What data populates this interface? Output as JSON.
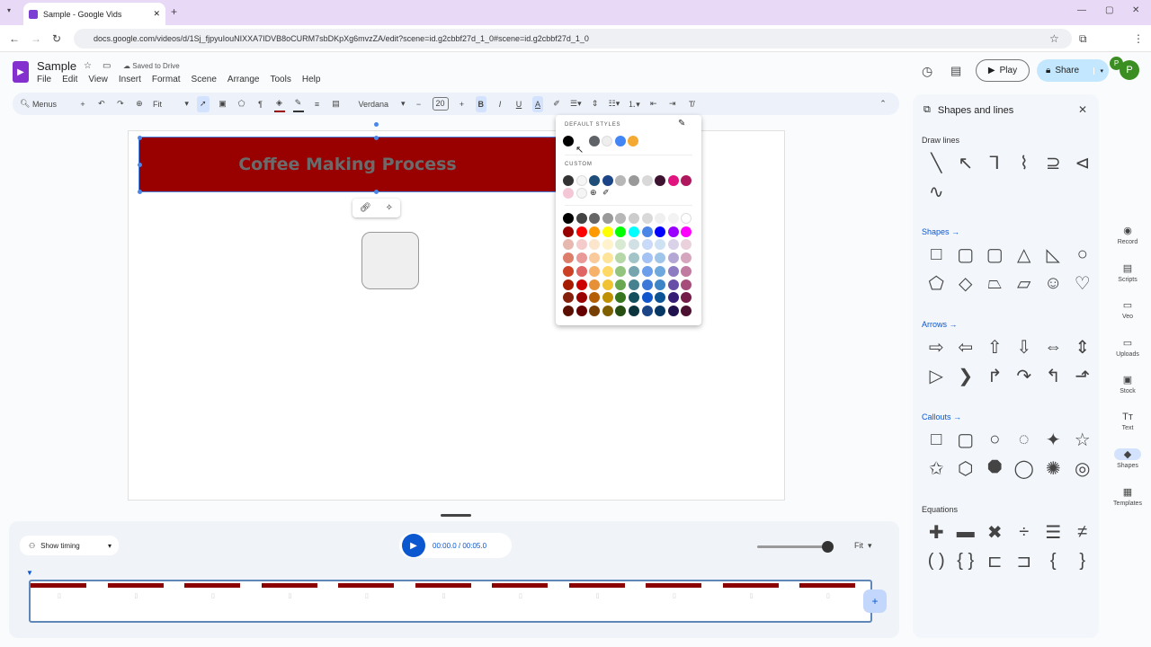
{
  "browser": {
    "tab_title": "Sample - Google Vids",
    "url": "docs.google.com/videos/d/1Sj_fjpyuIouNIXXA7IDVB8oCURM7sbDKpXg6mvzZA/edit?scene=id.g2cbbf27d_1_0#scene=id.g2cbbf27d_1_0",
    "avatar_letter": "P"
  },
  "app": {
    "title": "Sample",
    "save_status": "Saved to Drive",
    "menu": [
      "File",
      "Edit",
      "View",
      "Insert",
      "Format",
      "Scene",
      "Arrange",
      "Tools",
      "Help"
    ],
    "play_label": "Play",
    "share_label": "Share",
    "avatar_letter": "P"
  },
  "toolbar": {
    "search": "Menus",
    "zoom": "Fit",
    "font": "Verdana",
    "font_size": "20"
  },
  "slide": {
    "title_text": "Coffee Making Process"
  },
  "color_picker": {
    "default_label": "DEFAULT STYLES",
    "custom_label": "CUSTOM",
    "default_colors": [
      "#000000",
      "#5f6368",
      "#eeeeee",
      "#4285f4",
      "#f4a933"
    ],
    "custom_colors": [
      "#333333",
      "#f5f5f5",
      "#1f4e79",
      "#1c4587",
      "#b7b7b7",
      "#999999",
      "#d9d9d9",
      "#3d1330",
      "#e0137f",
      "#b0185e",
      "#f4c7d6",
      "#f5f5f5"
    ],
    "grid": [
      [
        "#000000",
        "#434343",
        "#666666",
        "#999999",
        "#b7b7b7",
        "#cccccc",
        "#d9d9d9",
        "#efefef",
        "#f3f3f3",
        "#ffffff"
      ],
      [
        "#980000",
        "#ff0000",
        "#ff9900",
        "#ffff00",
        "#00ff00",
        "#00ffff",
        "#4a86e8",
        "#0000ff",
        "#9900ff",
        "#ff00ff"
      ],
      [
        "#e6b8af",
        "#f4cccc",
        "#fce5cd",
        "#fff2cc",
        "#d9ead3",
        "#d0e0e3",
        "#c9daf8",
        "#cfe2f3",
        "#d9d2e9",
        "#ead1dc"
      ],
      [
        "#dd7e6b",
        "#ea9999",
        "#f9cb9c",
        "#ffe599",
        "#b6d7a8",
        "#a2c4c9",
        "#a4c2f4",
        "#9fc5e8",
        "#b4a7d6",
        "#d5a6bd"
      ],
      [
        "#cc4125",
        "#e06666",
        "#f6b26b",
        "#ffd966",
        "#93c47d",
        "#76a5af",
        "#6d9eeb",
        "#6fa8dc",
        "#8e7cc3",
        "#c27ba0"
      ],
      [
        "#a61c00",
        "#cc0000",
        "#e69138",
        "#f1c232",
        "#6aa84f",
        "#45818e",
        "#3c78d8",
        "#3d85c6",
        "#674ea7",
        "#a64d79"
      ],
      [
        "#85200c",
        "#990000",
        "#b45f06",
        "#bf9000",
        "#38761d",
        "#134f5c",
        "#1155cc",
        "#0b5394",
        "#351c75",
        "#741b47"
      ],
      [
        "#5b0f00",
        "#660000",
        "#783f04",
        "#7f6000",
        "#274e13",
        "#0c343d",
        "#1c4587",
        "#073763",
        "#20124d",
        "#4c1130"
      ]
    ]
  },
  "panel": {
    "title": "Shapes and lines",
    "sections": [
      {
        "label": "Draw lines",
        "link": false,
        "items": [
          "╲",
          "↖",
          "⅂",
          "⌇",
          "⊇",
          "⊲",
          "∿"
        ]
      },
      {
        "label": "Shapes →",
        "link": true,
        "items": [
          "□",
          "▢",
          "▢",
          "△",
          "◺",
          "○",
          "⬠",
          "◇",
          "⏢",
          "▱",
          "☺",
          "♡"
        ]
      },
      {
        "label": "Arrows →",
        "link": true,
        "items": [
          "⇨",
          "⇦",
          "⇧",
          "⇩",
          "⇔",
          "⇕",
          "▷",
          "❯",
          "↱",
          "↷",
          "↰",
          "⬏"
        ]
      },
      {
        "label": "Callouts →",
        "link": true,
        "items": [
          "□",
          "▢",
          "○",
          "◌",
          "✦",
          "☆",
          "✩",
          "⬡",
          "⯃",
          "◯",
          "✺",
          "◎"
        ]
      },
      {
        "label": "Equations",
        "link": false,
        "items": [
          "✚",
          "▬",
          "✖",
          "÷",
          "☰",
          "≠",
          "( )",
          "{ }",
          "⊏",
          "⊐",
          "{",
          "}"
        ]
      }
    ]
  },
  "rail": [
    {
      "label": "Record",
      "icon": "◉"
    },
    {
      "label": "Scripts",
      "icon": "▤"
    },
    {
      "label": "Veo",
      "icon": "▭"
    },
    {
      "label": "Uploads",
      "icon": "▭"
    },
    {
      "label": "Stock",
      "icon": "▣"
    },
    {
      "label": "Text",
      "icon": "Tт"
    },
    {
      "label": "Shapes",
      "icon": "◆"
    },
    {
      "label": "Templates",
      "icon": "▦"
    }
  ],
  "timeline": {
    "show_timing": "Show timing",
    "time": "00:00.0 / 00:05.0",
    "zoom": "Fit",
    "segments": 11
  }
}
